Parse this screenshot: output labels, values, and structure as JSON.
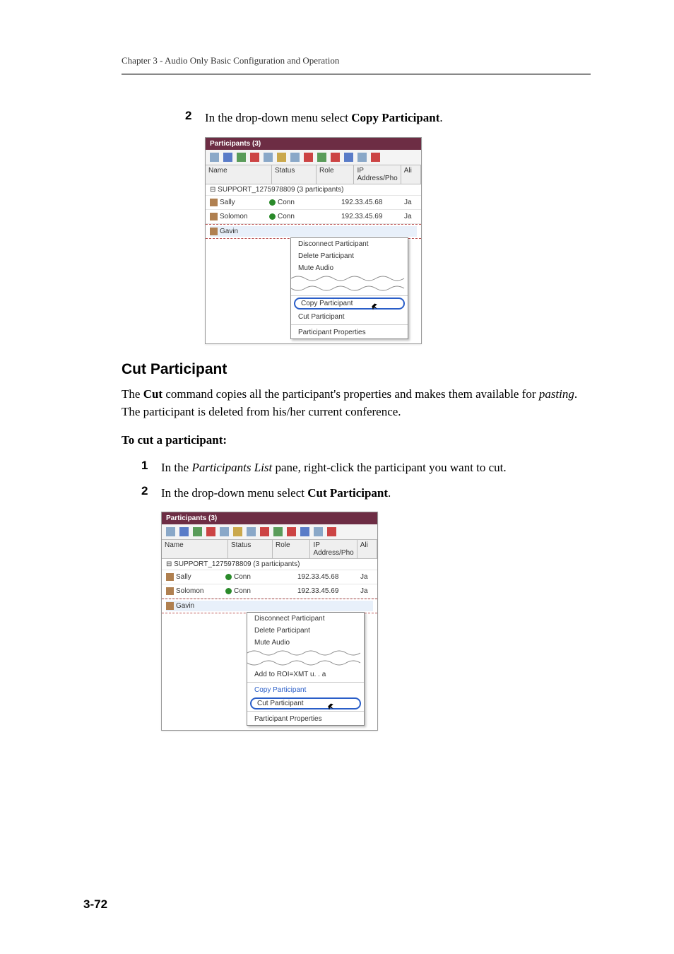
{
  "chapter_header": "Chapter 3 - Audio Only Basic Configuration and Operation",
  "copy_section": {
    "step_num": "2",
    "step_text_a": "In the drop-down menu select ",
    "step_text_b": "Copy Participant",
    "step_text_c": "."
  },
  "cut_section": {
    "heading": "Cut Participant",
    "para1_a": "The ",
    "para1_b": "Cut",
    "para1_c": " command copies all the participant's properties and makes them available for ",
    "para1_d": "pasting",
    "para1_e": ". The participant is deleted from his/her current conference.",
    "runin": "To cut a participant:",
    "step1_num": "1",
    "step1_a": "In the ",
    "step1_b": "Participants List",
    "step1_c": " pane, right-click the participant you want to cut.",
    "step2_num": "2",
    "step2_a": "In the drop-down menu select ",
    "step2_b": "Cut Participant",
    "step2_c": "."
  },
  "screenshot": {
    "title": "Participants (3)",
    "columns": {
      "name": "Name",
      "status": "Status",
      "role": "Role",
      "ip": "IP Address/Pho",
      "ali": "Ali"
    },
    "group": "SUPPORT_1275978809 (3  participants)",
    "rows": [
      {
        "name": "Sally",
        "status": "Conn",
        "ip": "192.33.45.68",
        "ali": "Ja"
      },
      {
        "name": "Solomon",
        "status": "Conn",
        "ip": "192.33.45.69",
        "ali": "Ja"
      },
      {
        "name": "Gavin",
        "status": "",
        "ip": "",
        "ali": ""
      }
    ],
    "menu1": {
      "items_top": [
        "Disconnect Participant",
        "Delete Participant",
        "Mute Audio"
      ],
      "highlight": "Copy Participant",
      "below": "Cut Participant",
      "bottom": "Participant Properties"
    },
    "menu2": {
      "items_top": [
        "Disconnect Participant",
        "Delete Participant",
        "Mute Audio"
      ],
      "mid": "Add to ROI=XMT u. . a",
      "above": "Copy Participant",
      "highlight": "Cut Participant",
      "bottom": "Participant Properties"
    }
  },
  "page_number": "3-72"
}
